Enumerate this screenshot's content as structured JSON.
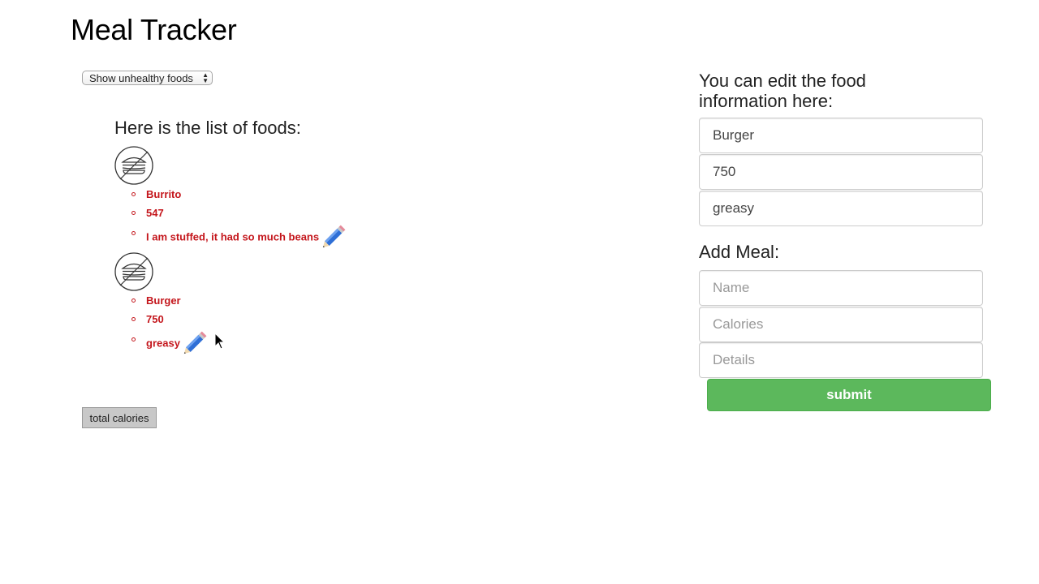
{
  "app": {
    "title": "Meal Tracker"
  },
  "filter": {
    "selected": "Show unhealthy foods"
  },
  "list": {
    "heading": "Here is the list of foods:",
    "foods": [
      {
        "name": "Burrito",
        "calories": "547",
        "details": "I am stuffed, it had so much beans",
        "icon": "no-burger-icon"
      },
      {
        "name": "Burger",
        "calories": "750",
        "details": "greasy",
        "icon": "no-burger-icon"
      }
    ]
  },
  "total": {
    "label": "total calories"
  },
  "edit": {
    "heading": "You can edit the food information here:",
    "name_value": "Burger",
    "calories_value": "750",
    "details_value": "greasy"
  },
  "add": {
    "heading": "Add Meal:",
    "name_placeholder": "Name",
    "calories_placeholder": "Calories",
    "details_placeholder": "Details",
    "submit_label": "submit"
  },
  "colors": {
    "accent_red": "#c4161c",
    "submit_green": "#5cb85c"
  }
}
